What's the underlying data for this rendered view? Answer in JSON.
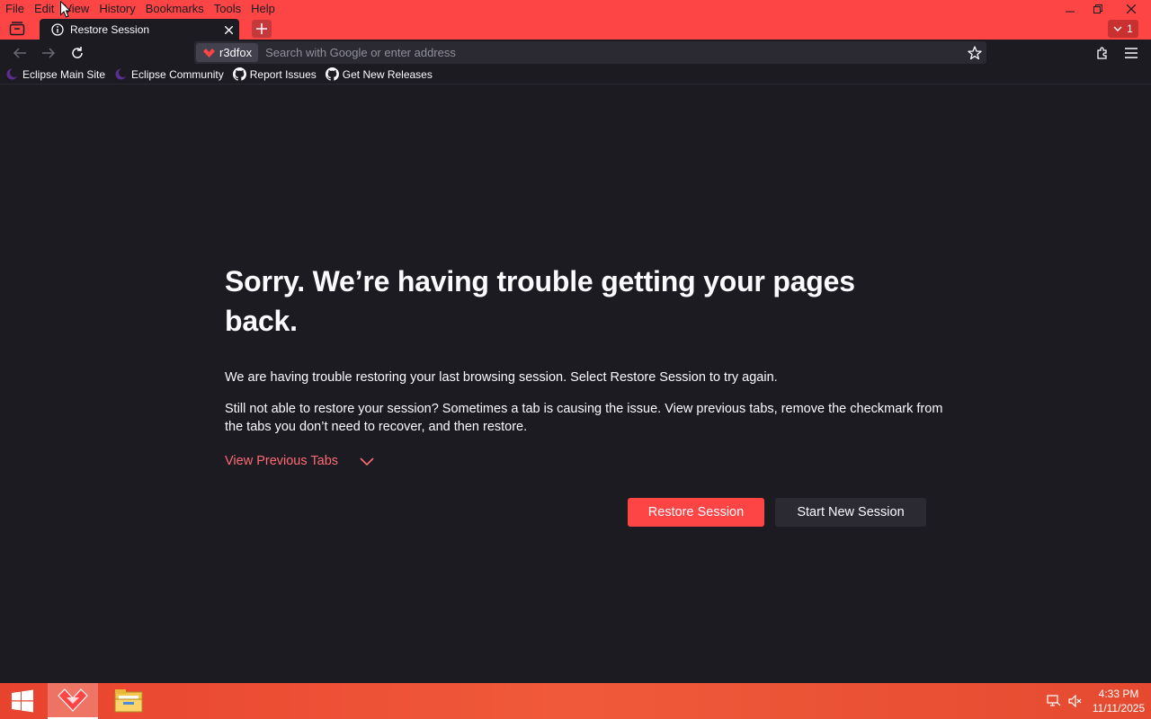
{
  "menu": [
    "File",
    "Edit",
    "View",
    "History",
    "Bookmarks",
    "Tools",
    "Help"
  ],
  "tab": {
    "title": "Restore Session"
  },
  "tab_counter": "1",
  "urlbar": {
    "identity": "r3dfox",
    "placeholder": "Search with Google or enter address"
  },
  "bookmarks": [
    {
      "label": "Eclipse Main Site",
      "icon": "eclipse-icon"
    },
    {
      "label": "Eclipse Community",
      "icon": "eclipse-icon"
    },
    {
      "label": "Report Issues",
      "icon": "github-icon"
    },
    {
      "label": "Get New Releases",
      "icon": "github-icon"
    }
  ],
  "content": {
    "heading": "Sorry. We’re having trouble getting your pages back.",
    "para1": "We are having trouble restoring your last browsing session. Select Restore Session to try again.",
    "para2": "Still not able to restore your session? Sometimes a tab is causing the issue. View previous tabs, remove the checkmark from the tabs you don’t need to recover, and then restore.",
    "view_previous": "View Previous Tabs",
    "restore_button": "Restore Session",
    "new_session_button": "Start New Session"
  },
  "taskbar": {
    "time": "4:33 PM",
    "date": "11/11/2025"
  },
  "colors": {
    "accent": "#fd4545",
    "background": "#1c1b22",
    "link": "#ff6a75",
    "taskbar": "#e8432f"
  }
}
